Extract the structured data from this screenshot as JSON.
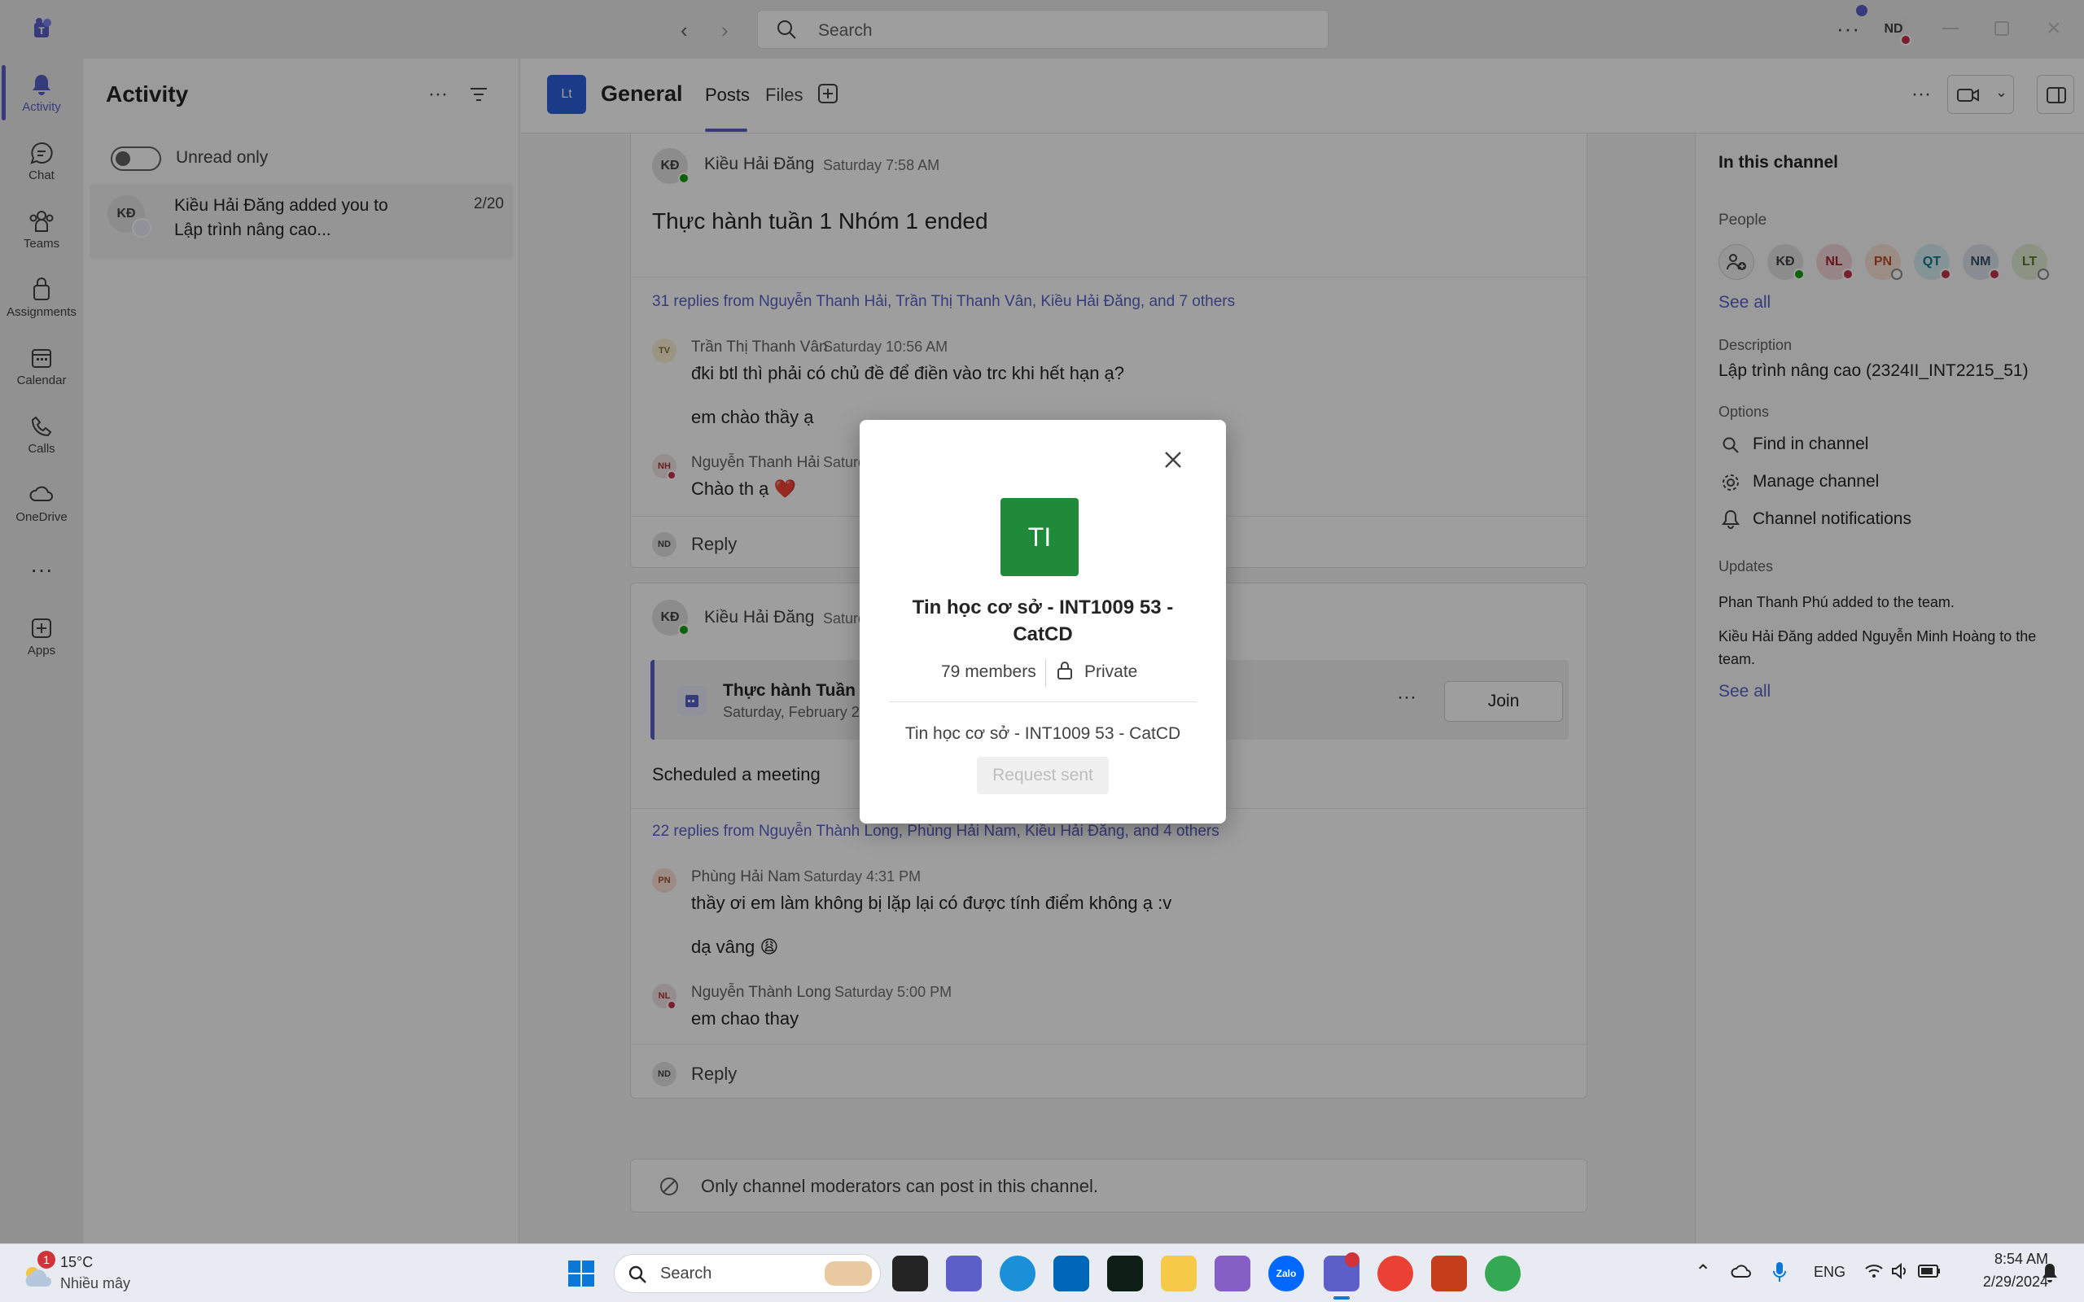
{
  "titlebar": {
    "search_placeholder": "Search",
    "user_initials": "ND"
  },
  "rail": {
    "items": [
      {
        "label": "Activity"
      },
      {
        "label": "Chat"
      },
      {
        "label": "Teams"
      },
      {
        "label": "Assignments"
      },
      {
        "label": "Calendar"
      },
      {
        "label": "Calls"
      },
      {
        "label": "OneDrive"
      },
      {
        "label": "Apps"
      }
    ]
  },
  "activity": {
    "title": "Activity",
    "toggle_label": "Unread only",
    "feed": [
      {
        "initials": "KĐ",
        "text": "Kiều Hải Đăng added you to Lập trình nâng cao...",
        "date": "2/20"
      }
    ]
  },
  "channel": {
    "team_initials": "Lt",
    "name": "General",
    "tabs": [
      "Posts",
      "Files"
    ],
    "active_tab": "Posts"
  },
  "posts": {
    "post1": {
      "author_initials": "KĐ",
      "author": "Kiều Hải Đăng",
      "time": "Saturday 7:58 AM",
      "title": "Thực hành tuần 1 Nhóm 1 ended",
      "replies_summary": "31 replies from Nguyễn Thanh Hải, Trần Thị Thanh Vân, Kiều Hải Đăng, and 7 others",
      "replies": [
        {
          "initials": "TV",
          "author": "Trần Thị Thanh Vân",
          "time": "Saturday 10:56 AM",
          "lines": [
            "đki btl thì phải có chủ đề để điền vào trc khi hết hạn ạ?",
            "em chào thầy ạ"
          ]
        },
        {
          "initials": "NH",
          "author": "Nguyễn Thanh Hải",
          "time": "Saturday",
          "lines": [
            "Chào th ạ ❤️"
          ]
        }
      ],
      "reply_label": "Reply",
      "reply_initials": "ND"
    },
    "post2": {
      "author_initials": "KĐ",
      "author": "Kiều Hải Đăng",
      "time": "Saturday",
      "meeting_title": "Thực hành Tuần 1",
      "meeting_date": "Saturday, February 2",
      "join_label": "Join",
      "body": "Scheduled a meeting",
      "replies_summary": "22 replies from Nguyễn Thành Long, Phùng Hải Nam, Kiều Hải Đăng, and 4 others",
      "replies": [
        {
          "initials": "PN",
          "author": "Phùng Hải Nam",
          "time": "Saturday 4:31 PM",
          "lines": [
            "thầy ơi em làm không bị lặp lại có được tính điểm không ạ :v",
            "dạ vâng 😩"
          ]
        },
        {
          "initials": "NL",
          "author": "Nguyễn Thành Long",
          "time": "Saturday 5:00 PM",
          "lines": [
            "em chao thay"
          ]
        }
      ],
      "reply_label": "Reply",
      "reply_initials": "ND"
    },
    "moderators_notice": "Only channel moderators can post in this channel."
  },
  "right_pane": {
    "title": "In this channel",
    "people_label": "People",
    "people": [
      "KĐ",
      "NL",
      "PN",
      "QT",
      "NM",
      "LT"
    ],
    "see_all": "See all",
    "description_label": "Description",
    "description": "Lập trình nâng cao (2324II_INT2215_51)",
    "options_label": "Options",
    "options": [
      "Find in channel",
      "Manage channel",
      "Channel notifications"
    ],
    "updates_label": "Updates",
    "updates": [
      "Phan Thanh Phú added  to the team.",
      "Kiều Hải Đăng added Nguyễn Minh Hoàng to the team."
    ],
    "updates_see_all": "See all"
  },
  "dialog": {
    "avatar_initials": "TI",
    "team_name": "Tin học cơ sở - INT1009 53 - CatCD",
    "members": "79 members",
    "privacy": "Private",
    "description": "Tin học cơ sở - INT1009 53 - CatCD",
    "request_label": "Request sent"
  },
  "taskbar": {
    "weather_badge": "1",
    "temperature": "15°C",
    "weather_desc": "Nhiều mây",
    "search_label": "Search",
    "language": "ENG",
    "time": "8:54 AM",
    "date": "2/29/2024"
  },
  "colors": {
    "brand": "#5b5fc7",
    "dialog_avatar": "#1f8a3a",
    "team_avatar": "#2b5fd9"
  }
}
